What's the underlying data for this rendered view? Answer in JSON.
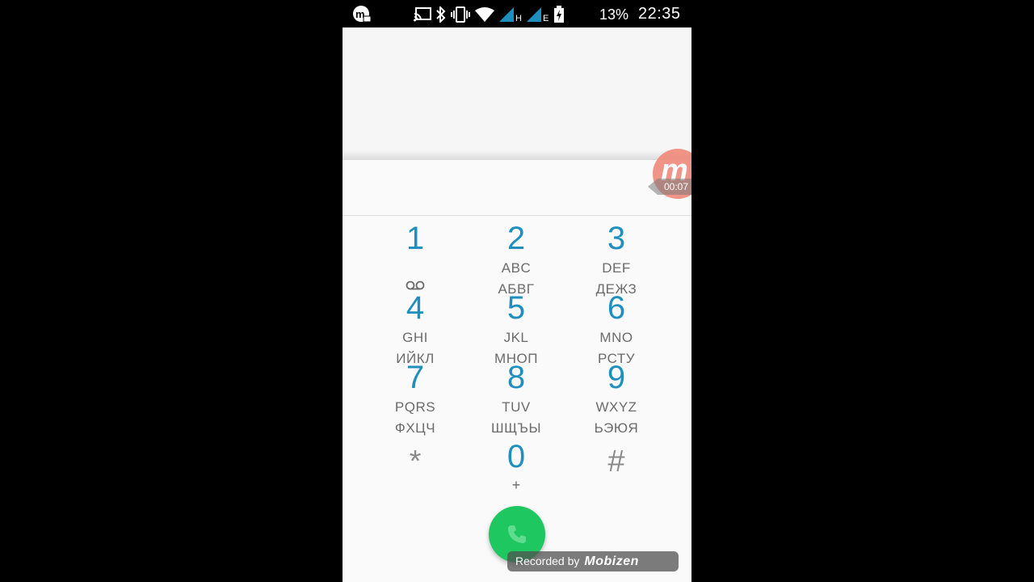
{
  "status_bar": {
    "battery_percent": "13%",
    "time": "22:35",
    "network_h": "H",
    "network_e": "E",
    "icons": [
      "mobizen-icon",
      "cast-icon",
      "bluetooth-icon",
      "vibrate-icon",
      "wifi-icon",
      "signal-icon",
      "signal-icon",
      "battery-charging-icon"
    ]
  },
  "dialpad": {
    "keys": [
      {
        "digit": "1",
        "latin": "",
        "cyrillic": "",
        "icon": "voicemail-icon"
      },
      {
        "digit": "2",
        "latin": "ABC",
        "cyrillic": "АБВГ"
      },
      {
        "digit": "3",
        "latin": "DEF",
        "cyrillic": "ДЕЖЗ"
      },
      {
        "digit": "4",
        "latin": "GHI",
        "cyrillic": "ИЙКЛ"
      },
      {
        "digit": "5",
        "latin": "JKL",
        "cyrillic": "МНОП"
      },
      {
        "digit": "6",
        "latin": "MNO",
        "cyrillic": "РСТУ"
      },
      {
        "digit": "7",
        "latin": "PQRS",
        "cyrillic": "ФХЦЧ"
      },
      {
        "digit": "8",
        "latin": "TUV",
        "cyrillic": "ШЩЪЫ"
      },
      {
        "digit": "9",
        "latin": "WXYZ",
        "cyrillic": "ЬЭЮЯ"
      },
      {
        "digit": "*",
        "latin": "",
        "cyrillic": ""
      },
      {
        "digit": "0",
        "latin": "+",
        "cyrillic": ""
      },
      {
        "digit": "#",
        "latin": "",
        "cyrillic": ""
      }
    ],
    "call_button_icon": "phone-icon"
  },
  "overlay": {
    "bubble_letter": "m",
    "timer": "00:07",
    "watermark_label": "Recorded by",
    "watermark_brand": "Mobizen"
  },
  "colors": {
    "digit": "#1e8fbf",
    "letters": "#6b6b6b",
    "call_button": "#1ec760",
    "bubble": "#f08a7b"
  }
}
